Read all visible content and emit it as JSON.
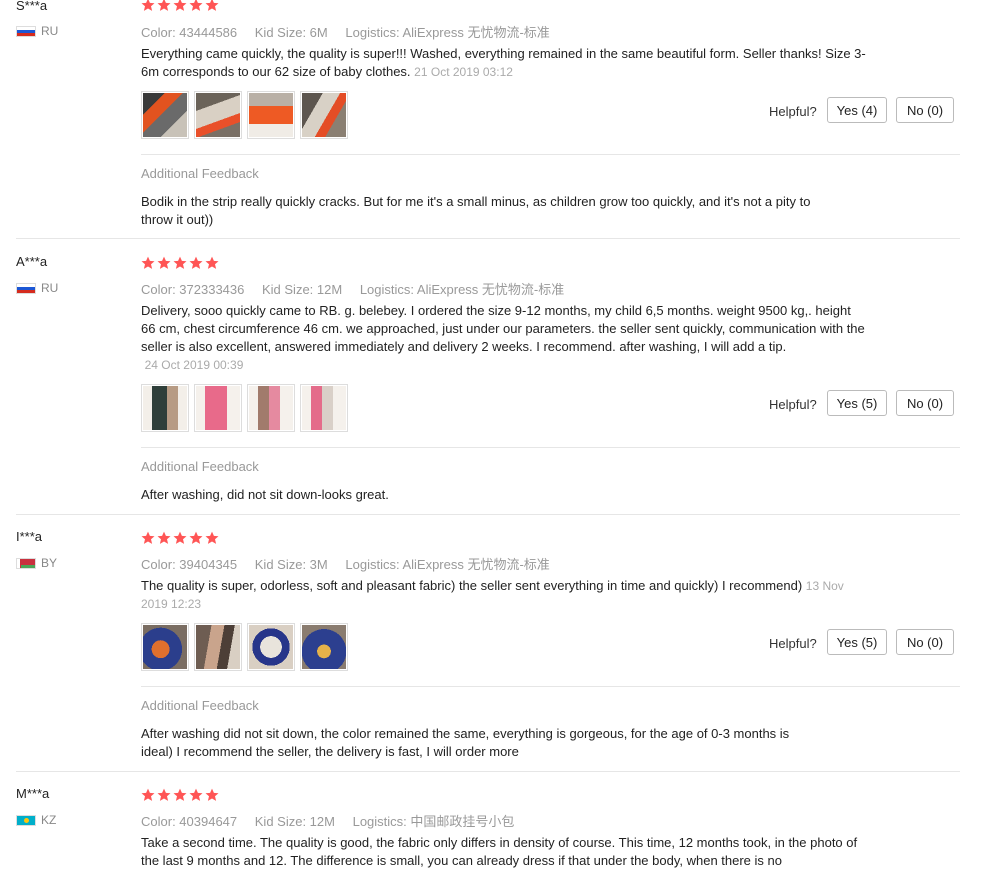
{
  "colors": {
    "star": "#f55",
    "text": "#222222",
    "muted": "#999999"
  },
  "reviews": [
    {
      "user": "S***a",
      "country": "RU",
      "flag": "ru",
      "rating": 5,
      "color": "Color: 43444586",
      "size": "Kid Size: 6M",
      "logistics": "Logistics: AliExpress 无忧物流-标准",
      "text": "Everything came quickly, the quality is super!!! Washed, everything remained in the same beautiful form. Seller thanks! Size 3-6m corresponds to our 62 size of baby clothes.",
      "date": "21 Oct 2019 03:12",
      "helpful": "Helpful?",
      "yes": "Yes (4)",
      "no": "No (0)",
      "additional_label": "Additional Feedback",
      "additional_text": "Bodik in the strip really quickly cracks. But for me it's a small minus, as children grow too quickly, and it's not a pity to throw it out))"
    },
    {
      "user": "A***a",
      "country": "RU",
      "flag": "ru",
      "rating": 5,
      "color": "Color: 372333436",
      "size": "Kid Size: 12M",
      "logistics": "Logistics: AliExpress 无忧物流-标准",
      "text": "Delivery, sooo quickly came to RB. g. belebey. I ordered the size 9-12 months, my child 6,5 months. weight 9500 kg,. height 66 cm, chest circumference 46 cm. we approached, just under our parameters. the seller sent quickly, communication with the seller is also excellent, answered immediately and delivery 2 weeks. I recommend. after washing, I will add a tip.",
      "date": "24 Oct 2019 00:39",
      "helpful": "Helpful?",
      "yes": "Yes (5)",
      "no": "No (0)",
      "additional_label": "Additional Feedback",
      "additional_text": "After washing, did not sit down-looks great."
    },
    {
      "user": "I***a",
      "country": "BY",
      "flag": "by",
      "rating": 5,
      "color": "Color: 39404345",
      "size": "Kid Size: 3M",
      "logistics": "Logistics: AliExpress 无忧物流-标准",
      "text": "The quality is super, odorless, soft and pleasant fabric) the seller sent everything in time and quickly) I recommend)",
      "date": "13 Nov 2019 12:23",
      "helpful": "Helpful?",
      "yes": "Yes (5)",
      "no": "No (0)",
      "additional_label": "Additional Feedback",
      "additional_text": "After washing did not sit down, the color remained the same, everything is gorgeous, for the age of 0-3 months is ideal) I recommend the seller, the delivery is fast, I will order more"
    },
    {
      "user": "M***a",
      "country": "KZ",
      "flag": "kz",
      "rating": 5,
      "color": "Color: 40394647",
      "size": "Kid Size: 12M",
      "logistics": "Logistics: 中国邮政挂号小包",
      "text": "Take a second time. The quality is good, the fabric only differs in density of course. This time, 12 months took, in the photo of the last 9 months and 12. The difference is small, you can already dress if that under the body, when there is no"
    }
  ]
}
